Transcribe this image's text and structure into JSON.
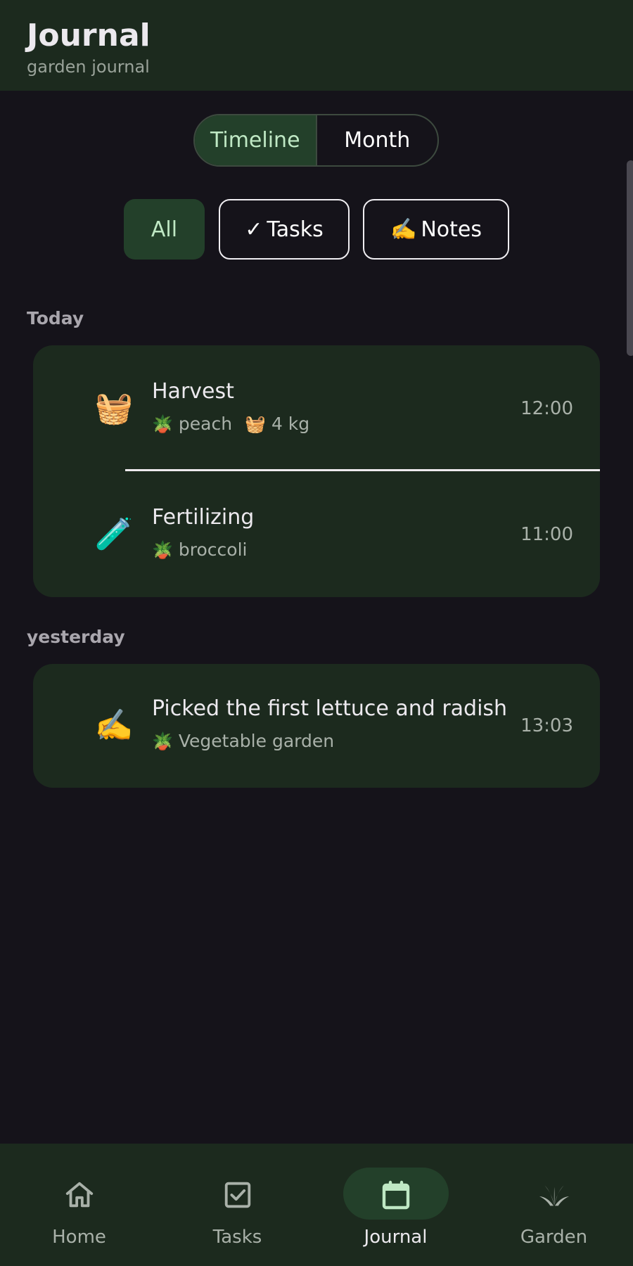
{
  "header": {
    "title": "Journal",
    "subtitle": "garden journal"
  },
  "view_toggle": {
    "options": [
      {
        "label": "Timeline",
        "selected": true
      },
      {
        "label": "Month",
        "selected": false
      }
    ]
  },
  "filters": {
    "all": "All",
    "tasks_glyph": "✓",
    "tasks": "Tasks",
    "notes_glyph": "✍️",
    "notes": "Notes"
  },
  "sections": [
    {
      "label": "Today",
      "entries": [
        {
          "icon": "🧺",
          "icon_name": "basket-icon",
          "title": "Harvest",
          "tags": [
            {
              "emoji": "🪴",
              "text": "peach"
            },
            {
              "emoji": "🧺",
              "text": "4 kg"
            }
          ],
          "time": "12:00"
        },
        {
          "icon": "🧪",
          "icon_name": "test-tube-icon",
          "title": "Fertilizing",
          "tags": [
            {
              "emoji": "🪴",
              "text": "broccoli"
            }
          ],
          "time": "11:00"
        }
      ]
    },
    {
      "label": "yesterday",
      "entries": [
        {
          "icon": "✍️",
          "icon_name": "writing-hand-icon",
          "title": "Picked the first lettuce and radish",
          "tags": [
            {
              "emoji": "🪴",
              "text": "Vegetable garden"
            }
          ],
          "time": "13:03"
        }
      ]
    }
  ],
  "bottom_nav": {
    "items": [
      {
        "label": "Home",
        "icon": "home-icon",
        "active": false
      },
      {
        "label": "Tasks",
        "icon": "checkbox-icon",
        "active": false
      },
      {
        "label": "Journal",
        "icon": "calendar-icon",
        "active": true
      },
      {
        "label": "Garden",
        "icon": "sprout-icon",
        "active": false
      }
    ]
  },
  "colors": {
    "background": "#15131a",
    "surface": "#1c2a1e",
    "accent_container": "#23402a",
    "accent_text": "#bfe8c4"
  }
}
